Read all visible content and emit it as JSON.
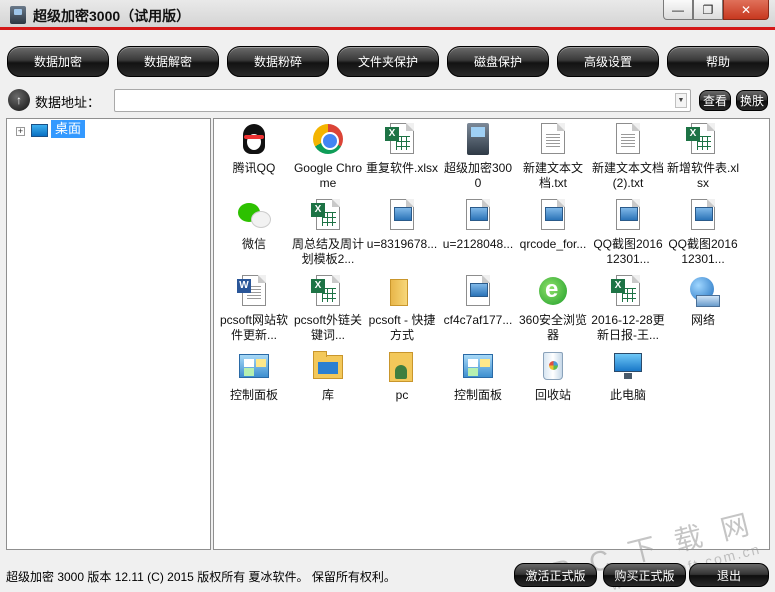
{
  "window": {
    "title": "超级加密3000（试用版）",
    "buttons": {
      "minimize": "—",
      "maximize": "❐",
      "close": "✕"
    }
  },
  "toolbar": {
    "buttons": [
      "数据加密",
      "数据解密",
      "数据粉碎",
      "文件夹保护",
      "磁盘保护",
      "高级设置",
      "帮助"
    ]
  },
  "address": {
    "label": "数据地址：",
    "value": "",
    "view_button": "查看",
    "skin_button": "换肤"
  },
  "tree": {
    "expander": "+",
    "root_label": "桌面"
  },
  "files": [
    {
      "label": "腾讯QQ",
      "icon": "qq-icon"
    },
    {
      "label": "Google Chrome",
      "icon": "chrome-icon"
    },
    {
      "label": "重复软件.xlsx",
      "icon": "excel-file-icon"
    },
    {
      "label": "超级加密3000",
      "icon": "app-icon"
    },
    {
      "label": "新建文本文档.txt",
      "icon": "text-file-icon"
    },
    {
      "label": "新建文本文档 (2).txt",
      "icon": "text-file-icon"
    },
    {
      "label": "新增软件表.xlsx",
      "icon": "excel-file-icon"
    },
    {
      "label": "微信",
      "icon": "wechat-icon"
    },
    {
      "label": "周总结及周计划模板2...",
      "icon": "excel-file-icon"
    },
    {
      "label": "u=8319678...",
      "icon": "image-file-icon"
    },
    {
      "label": "u=2128048...",
      "icon": "image-file-icon"
    },
    {
      "label": "qrcode_for...",
      "icon": "image-file-icon"
    },
    {
      "label": "QQ截图201612301...",
      "icon": "image-file-icon"
    },
    {
      "label": "QQ截图201612301...",
      "icon": "image-file-icon"
    },
    {
      "label": "pcsoft网站软件更新...",
      "icon": "word-file-icon"
    },
    {
      "label": "pcsoft外链关键词...",
      "icon": "excel-file-icon"
    },
    {
      "label": "pcsoft - 快捷方式",
      "icon": "folder-shortcut-icon"
    },
    {
      "label": "cf4c7af177...",
      "icon": "image-file-icon"
    },
    {
      "label": "360安全浏览器",
      "icon": "browser-360-icon"
    },
    {
      "label": "2016-12-28更新日报-王...",
      "icon": "excel-file-icon"
    },
    {
      "label": "网络",
      "icon": "network-icon"
    },
    {
      "label": "控制面板",
      "icon": "control-panel-icon"
    },
    {
      "label": "库",
      "icon": "library-icon"
    },
    {
      "label": "pc",
      "icon": "user-folder-icon"
    },
    {
      "label": "控制面板",
      "icon": "control-panel-icon"
    },
    {
      "label": "回收站",
      "icon": "recycle-bin-icon"
    },
    {
      "label": "此电脑",
      "icon": "computer-icon"
    }
  ],
  "status": {
    "text": "超级加密 3000  版本 12.11  (C)  2015 版权所有 夏冰软件。 保留所有权利。",
    "activate_button": "激活正式版",
    "buy_button": "购买正式版",
    "exit_button": "退出"
  },
  "watermark": {
    "line1": "P C 下 载 网",
    "line2": "www.pcsoft.com.cn"
  }
}
